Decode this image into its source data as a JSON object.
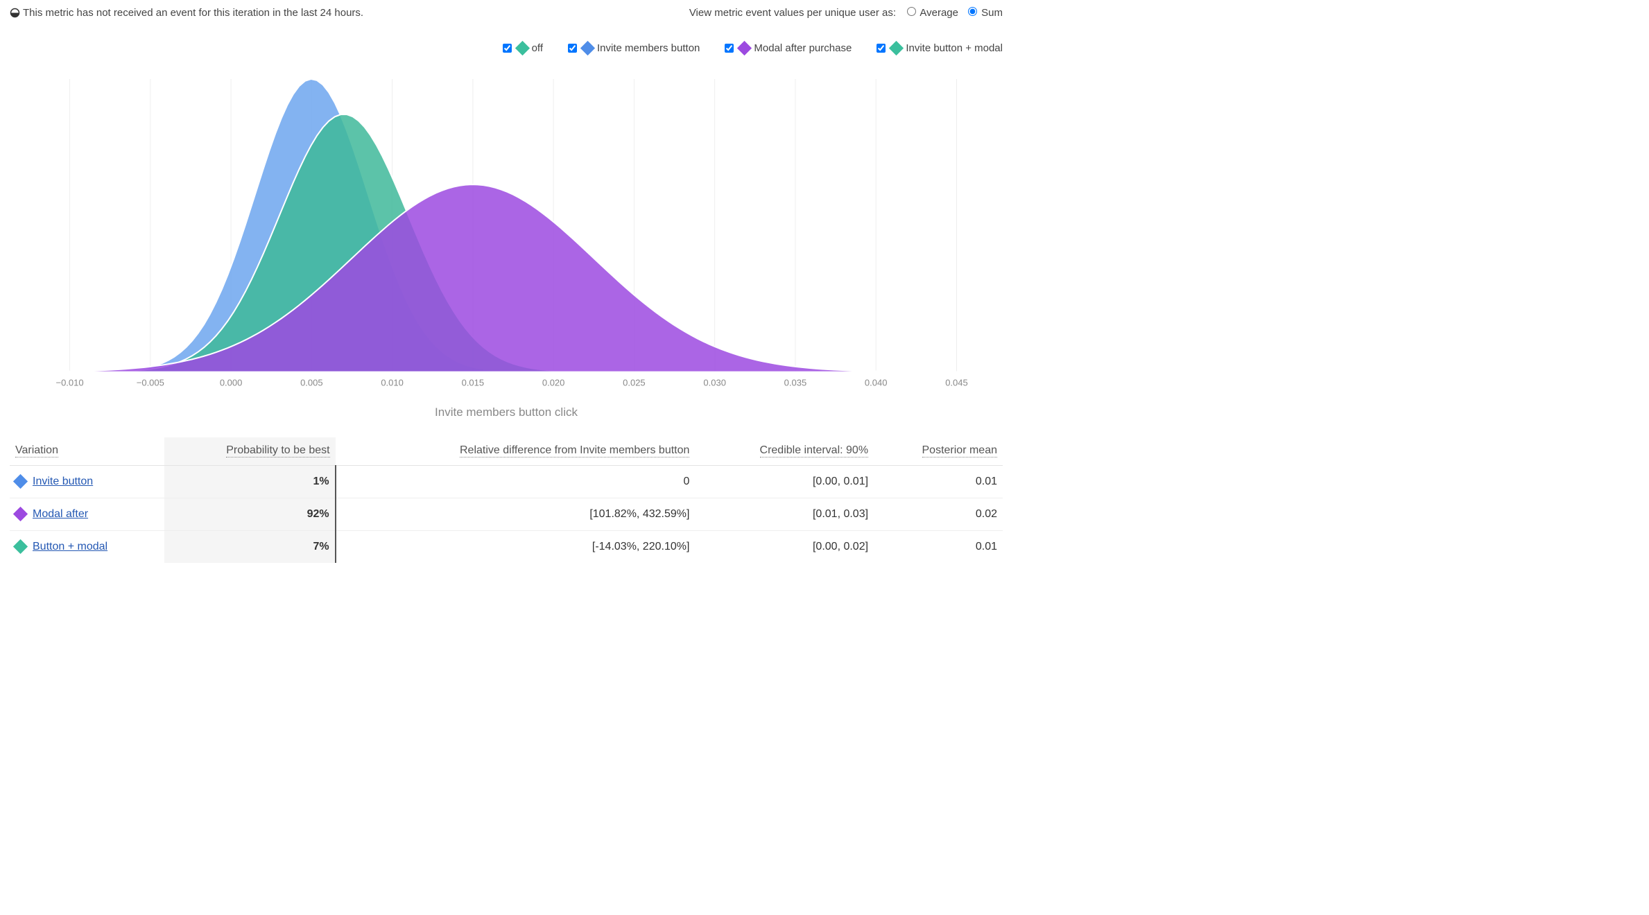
{
  "warning_text": "This metric has not received an event for this iteration in the last 24 hours.",
  "view_as": {
    "label": "View metric event values per unique user as:",
    "options": [
      "Average",
      "Sum"
    ],
    "selected": "Sum"
  },
  "legend": [
    {
      "label": "off",
      "color": "teal"
    },
    {
      "label": "Invite members button",
      "color": "blue"
    },
    {
      "label": "Modal after purchase",
      "color": "purple"
    },
    {
      "label": "Invite button + modal",
      "color": "green2"
    }
  ],
  "chart_title": "Invite members button click",
  "chart_data": {
    "type": "area",
    "xlabel": "Invite members button click",
    "ylabel": "",
    "xlim": [
      -0.012,
      0.047
    ],
    "x_ticks": [
      -0.01,
      -0.005,
      0.0,
      0.005,
      0.01,
      0.015,
      0.02,
      0.025,
      0.03,
      0.035,
      0.04,
      0.045
    ],
    "x_tick_labels": [
      "−0.010",
      "−0.005",
      "0.000",
      "0.005",
      "0.010",
      "0.015",
      "0.020",
      "0.025",
      "0.030",
      "0.035",
      "0.040",
      "0.045"
    ],
    "note": "Posterior density curves per variation; y-axis unlabeled (density). Peak positions and widths estimated from gridlines.",
    "series": [
      {
        "name": "Invite members button",
        "color": "#6da6ef",
        "mean": 0.005,
        "sd": 0.0035,
        "peak_rel": 1.0
      },
      {
        "name": "Invite button + modal",
        "color": "#3fb99a",
        "mean": 0.007,
        "sd": 0.004,
        "peak_rel": 0.88
      },
      {
        "name": "Modal after purchase",
        "color": "#9c4ae0",
        "mean": 0.015,
        "sd": 0.0075,
        "peak_rel": 0.64
      }
    ]
  },
  "table": {
    "headers": {
      "variation": "Variation",
      "prob_best": "Probability to be best",
      "rel_diff": "Relative difference from Invite members button",
      "cred_int": "Credible interval: 90%",
      "post_mean": "Posterior mean"
    },
    "rows": [
      {
        "color": "blue",
        "name": "Invite button",
        "prob": "1%",
        "rel": "0",
        "ci": "[0.00, 0.01]",
        "mean": "0.01"
      },
      {
        "color": "purple",
        "name": "Modal after",
        "prob": "92%",
        "rel": "[101.82%, 432.59%]",
        "ci": "[0.01, 0.03]",
        "mean": "0.02"
      },
      {
        "color": "green2",
        "name": "Button + modal",
        "prob": "7%",
        "rel": "[-14.03%, 220.10%]",
        "ci": "[0.00, 0.02]",
        "mean": "0.01"
      }
    ]
  }
}
